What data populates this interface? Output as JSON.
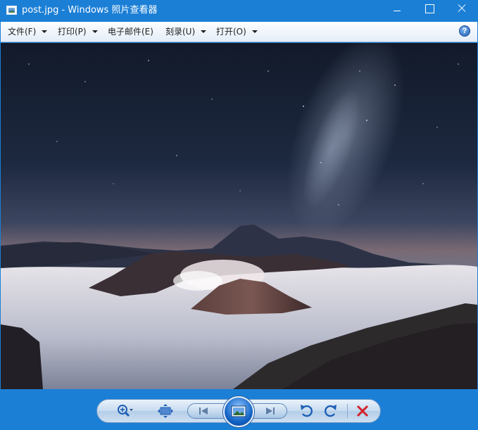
{
  "window": {
    "title": "post.jpg - Windows 照片查看器",
    "controls": [
      "minimize-icon",
      "maximize-icon",
      "close-icon"
    ]
  },
  "menu": {
    "items": [
      {
        "label": "文件(F)",
        "has_dropdown": true
      },
      {
        "label": "打印(P)",
        "has_dropdown": true
      },
      {
        "label": "电子邮件(E)",
        "has_dropdown": false
      },
      {
        "label": "刻录(U)",
        "has_dropdown": true
      },
      {
        "label": "打开(O)",
        "has_dropdown": true
      }
    ],
    "help_label": "?"
  },
  "photo": {
    "subject": "volcano-landscape-night",
    "colors": {
      "sky_top": "#141c2c",
      "horizon": "#7d6f78",
      "cloud": "#e6e2e8"
    }
  },
  "toolbar": {
    "buttons": [
      "zoom-icon",
      "fit-to-window-icon",
      "previous-icon",
      "slideshow-icon",
      "next-icon",
      "rotate-counterclockwise-icon",
      "rotate-clockwise-icon",
      "delete-icon"
    ],
    "accent": "#1b7fd6",
    "delete_color": "#d3232a"
  }
}
